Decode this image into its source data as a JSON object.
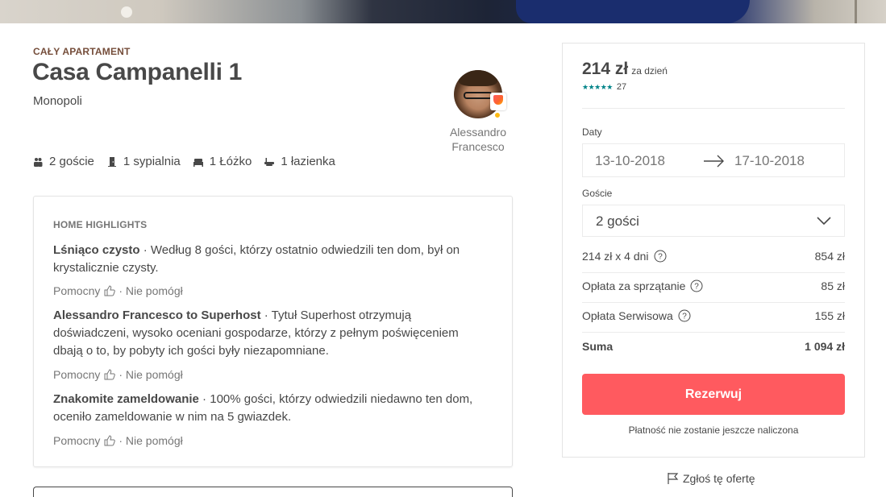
{
  "listing": {
    "kicker": "CAŁY APARTAMENT",
    "title": "Casa Campanelli 1",
    "city": "Monopoli",
    "host_name": "Alessandro Francesco",
    "amenities": [
      {
        "icon": "guests-icon",
        "label": "2 goście"
      },
      {
        "icon": "door-icon",
        "label": "1 sypialnia"
      },
      {
        "icon": "bed-icon",
        "label": "1 Łóżko"
      },
      {
        "icon": "bath-icon",
        "label": "1 łazienka"
      }
    ]
  },
  "highlights": {
    "header": "HOME HIGHLIGHTS",
    "items": [
      {
        "title": "Lśniąco czysto",
        "text": " · Według 8 gości, którzy ostatnio odwiedzili ten dom, był on krystalicznie czysty."
      },
      {
        "title": "Alessandro Francesco to Superhost",
        "text": " · Tytuł Superhost otrzymują doświadczeni, wysoko oceniani gospodarze, którzy z pełnym poświęceniem dbają o to, by pobyty ich gości były niezapomniane."
      },
      {
        "title": "Znakomite zameldowanie",
        "text": " · 100% gości, którzy odwiedzili niedawno ten dom, oceniło zameldowanie w nim na 5 gwiazdek."
      }
    ],
    "helpful_label": "Pomocny",
    "not_helpful_label": "· Nie pomógł"
  },
  "booking": {
    "price": "214 zł",
    "price_unit": "za dzień",
    "stars": "★★★★★",
    "rating_value": 5,
    "review_count": "27",
    "dates_label": "Daty",
    "check_in": "13-10-2018",
    "check_out": "17-10-2018",
    "guests_label": "Goście",
    "guests_value": "2 gości",
    "lines": [
      {
        "label": "214 zł x 4 dni",
        "value": "854 zł"
      },
      {
        "label": "Opłata za sprzątanie",
        "value": "85 zł"
      },
      {
        "label": "Opłata Serwisowa",
        "value": "155 zł"
      }
    ],
    "total_label": "Suma",
    "total_value": "1 094 zł",
    "reserve_label": "Rezerwuj",
    "note": "Płatność nie zostanie jeszcze naliczona",
    "accent_color": "#ff5a5f",
    "star_color": "#008489"
  },
  "report": {
    "label": "Zgłoś tę ofertę"
  }
}
